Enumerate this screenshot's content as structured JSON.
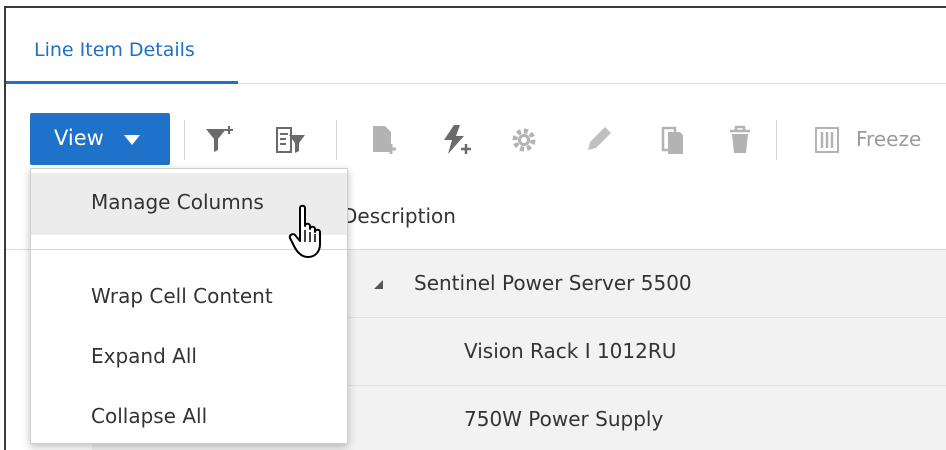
{
  "tabs": [
    {
      "label": "Line Item Details",
      "active": true
    }
  ],
  "toolbar": {
    "view_label": "View",
    "freeze_label": "Freeze",
    "icons": [
      "filter-add-icon",
      "filter-options-icon",
      "add-document-icon",
      "quick-add-icon",
      "settings-icon",
      "edit-icon",
      "copy-icon",
      "delete-icon",
      "freeze-icon"
    ]
  },
  "view_menu": {
    "items": [
      {
        "label": "Manage Columns",
        "hovered": true
      },
      {
        "label": "Wrap Cell Content"
      },
      {
        "label": "Expand All"
      },
      {
        "label": "Collapse All"
      }
    ]
  },
  "grid": {
    "header": "Description",
    "rows": [
      {
        "description": "Sentinel Power Server 5500",
        "expandable": true
      },
      {
        "description": "Vision Rack I 1012RU"
      },
      {
        "description": "750W Power Supply"
      }
    ]
  },
  "colors": {
    "accent": "#1f72c9",
    "tab_text": "#1e70c8",
    "disabled_icon": "#b3b3b3",
    "row_bg": "#f2f2f2",
    "menu_hover": "#ececec"
  }
}
